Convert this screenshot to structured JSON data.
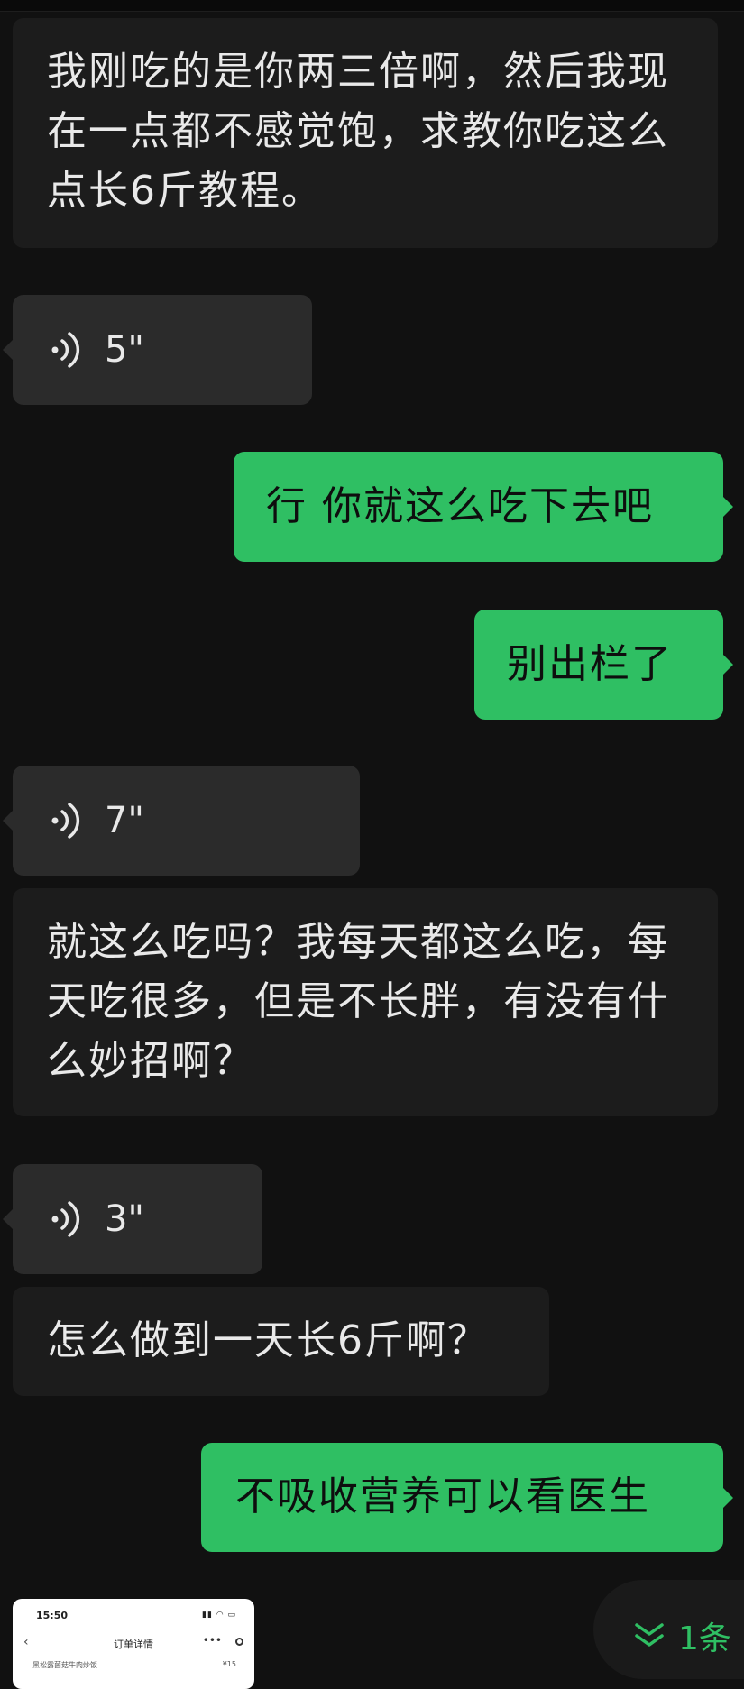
{
  "messages": [
    {
      "type": "incoming_text",
      "text": "我刚吃的是你两三倍啊，然后我现在一点都不感觉饱，求教你吃这么点长6斤教程。"
    },
    {
      "type": "incoming_voice",
      "duration": "5\""
    },
    {
      "type": "outgoing_text",
      "text": "行 你就这么吃下去吧"
    },
    {
      "type": "outgoing_text",
      "text": "别出栏了"
    },
    {
      "type": "incoming_voice",
      "duration": "7\""
    },
    {
      "type": "incoming_text",
      "text": "就这么吃吗？我每天都这么吃，每天吃很多，但是不长胖，有没有什么妙招啊？"
    },
    {
      "type": "incoming_voice",
      "duration": "3\""
    },
    {
      "type": "incoming_text",
      "text": "怎么做到一天长6斤啊？"
    },
    {
      "type": "outgoing_text",
      "text": "不吸收营养可以看医生"
    }
  ],
  "image_preview": {
    "time": "15:50",
    "title": "订单详情",
    "item": "黑松露菌菇牛肉炒饭",
    "price": "¥15"
  },
  "new_messages_label": "1条",
  "colors": {
    "background": "#111111",
    "incoming_bubble": "#1c1c1c",
    "voice_bubble": "#2b2b2b",
    "outgoing_bubble": "#2fbf63"
  }
}
